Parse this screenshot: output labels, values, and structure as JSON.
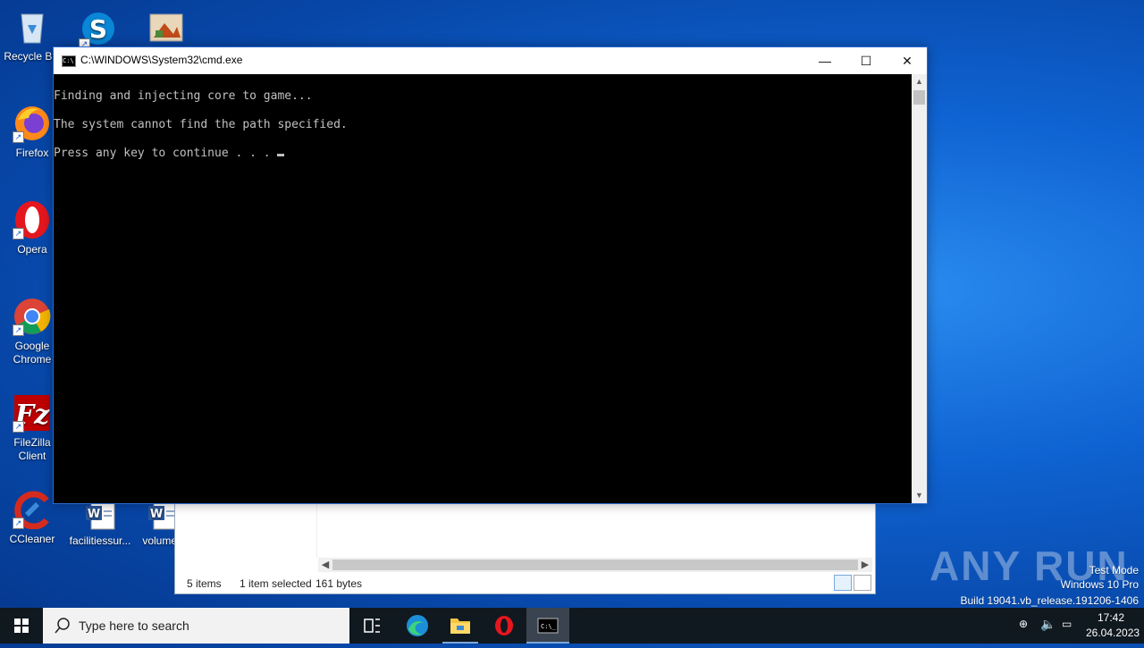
{
  "desktop": {
    "icons": [
      {
        "label": "Recycle Bin",
        "icon": "recycle-bin-icon"
      },
      {
        "label": "",
        "icon": "skype-icon"
      },
      {
        "label": "",
        "icon": "image-file-icon"
      },
      {
        "label": "Firefox",
        "icon": "firefox-icon"
      },
      {
        "label": "Opera",
        "icon": "opera-icon"
      },
      {
        "label": "Google Chrome",
        "icon": "chrome-icon"
      },
      {
        "label": "FileZilla Client",
        "icon": "filezilla-icon"
      },
      {
        "label": "CCleaner",
        "icon": "ccleaner-icon"
      },
      {
        "label": "facilitiessur...",
        "icon": "word-doc-icon"
      },
      {
        "label": "volume_",
        "icon": "word-doc-icon"
      }
    ]
  },
  "explorer": {
    "status_items": "5 items",
    "status_selected": "1 item selected",
    "status_size": "161 bytes"
  },
  "cmd": {
    "title": "C:\\WINDOWS\\System32\\cmd.exe",
    "lines": [
      "Finding and injecting core to game...",
      "The system cannot find the path specified.",
      "Press any key to continue . . . "
    ],
    "minimize": "—",
    "maximize": "☐",
    "close": "✕"
  },
  "taskbar": {
    "search_placeholder": "Type here to search",
    "apps": [
      "task-view-icon",
      "edge-icon",
      "file-explorer-icon",
      "opera-icon",
      "cmd-icon"
    ],
    "time": "17:42",
    "date": "26.04.2023"
  },
  "watermark": {
    "line1": "Test Mode",
    "line2": "Windows 10 Pro",
    "line3": "Build 19041.vb_release.191206-1406",
    "brand": "ANY RUN"
  },
  "colors": {
    "desktop": "#0f63d2",
    "taskbar": "#101820",
    "console_bg": "#000000",
    "console_fg": "#c0c0c0"
  }
}
